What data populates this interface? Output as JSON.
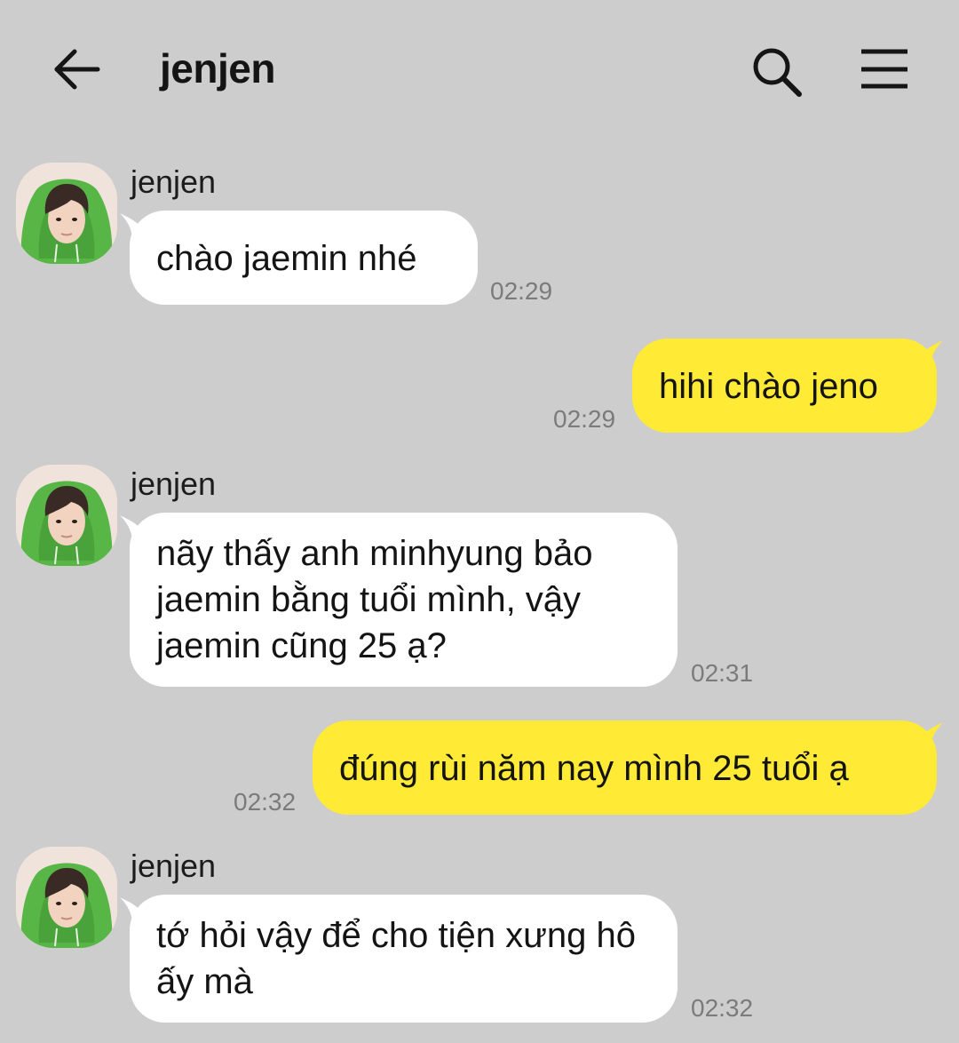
{
  "header": {
    "title": "jenjen"
  },
  "icons": {
    "back": "arrow-left-icon",
    "search": "search-icon",
    "menu": "hamburger-menu-icon"
  },
  "colors": {
    "background": "#cdcdcd",
    "incoming_bubble": "#ffffff",
    "outgoing_bubble": "#ffea35",
    "timestamp": "#7b7b7b"
  },
  "messages": [
    {
      "direction": "incoming",
      "sender": "jenjen",
      "text": "chào jaemin nhé",
      "time": "02:29"
    },
    {
      "direction": "outgoing",
      "text": "hihi chào jeno",
      "time": "02:29"
    },
    {
      "direction": "incoming",
      "sender": "jenjen",
      "text": "nãy thấy anh minhyung bảo jaemin bằng tuổi mình, vậy jaemin cũng 25 ạ?",
      "time": "02:31"
    },
    {
      "direction": "outgoing",
      "text": "đúng rùi năm nay mình 25 tuổi ạ",
      "time": "02:32"
    },
    {
      "direction": "incoming",
      "sender": "jenjen",
      "text": "tớ hỏi vậy để cho tiện xưng hô ấy mà",
      "time": "02:32"
    }
  ]
}
